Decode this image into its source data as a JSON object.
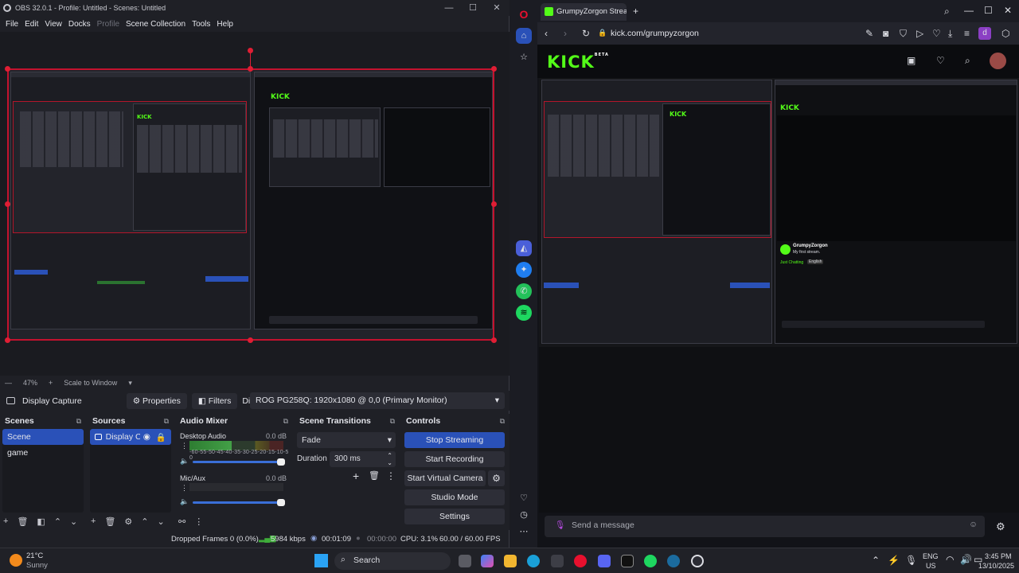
{
  "obs": {
    "title": "OBS 32.0.1 - Profile: Untitled - Scenes: Untitled",
    "menu": [
      "File",
      "Edit",
      "View",
      "Docks",
      "Profile",
      "Scene Collection",
      "Tools",
      "Help"
    ],
    "zoom": "47%",
    "scale_mode": "Scale to Window",
    "source_name": "Display Capture",
    "properties_label": "Properties",
    "filters_label": "Filters",
    "display_label": "Display",
    "display_value": "ROG PG258Q: 1920x1080 @ 0,0 (Primary Monitor)",
    "scenes": {
      "title": "Scenes",
      "items": [
        "Scene",
        "game"
      ],
      "selected": "Scene"
    },
    "sources": {
      "title": "Sources",
      "items": [
        "Display Cap"
      ]
    },
    "mixer": {
      "title": "Audio Mixer",
      "channels": [
        {
          "name": "Desktop Audio",
          "db": "0.0 dB"
        },
        {
          "name": "Mic/Aux",
          "db": "0.0 dB"
        }
      ],
      "ticks": "-60-55-50-45-40-35-30-25-20-15-10-5 0"
    },
    "transitions": {
      "title": "Scene Transitions",
      "selected": "Fade",
      "duration_label": "Duration",
      "duration_value": "300 ms"
    },
    "controls": {
      "title": "Controls",
      "buttons": [
        "Stop Streaming",
        "Start Recording",
        "Start Virtual Camera",
        "Studio Mode",
        "Settings"
      ]
    },
    "status": {
      "dropped": "Dropped Frames 0 (0.0%)",
      "bitrate": "5984 kbps",
      "stream_time": "00:01:09",
      "rec_time": "00:00:00",
      "cpu": "CPU: 3.1%",
      "fps": "60.00 / 60.00 FPS"
    }
  },
  "browser": {
    "tab_title": "GrumpyZorgon Strea",
    "url": "kick.com/grumpyzorgon",
    "logo": "KICK",
    "logo_badge": "BETA",
    "chat_placeholder": "Send a message",
    "profile_letter": "d",
    "mini_streamer": "GrumpyZorgon",
    "mini_title": "My first stream.",
    "mini_category": "Just Chatting",
    "mini_lang": "English"
  },
  "taskbar": {
    "weather_temp": "21°C",
    "weather_desc": "Sunny",
    "search": "Search",
    "lang": "ENG",
    "region": "US",
    "time": "3:45 PM",
    "date": "13/10/2025"
  },
  "colors": {
    "accent": "#2a51b8",
    "kick_green": "#53fc18",
    "selection_red": "#c4122e"
  }
}
